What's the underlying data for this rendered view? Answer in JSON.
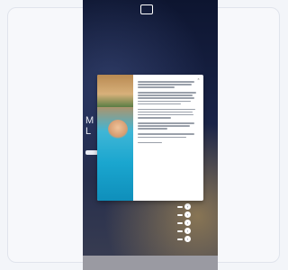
{
  "topbar": {
    "back_label": "",
    "logo_text": "",
    "nav": [
      "",
      "",
      "",
      ""
    ]
  },
  "hero": {
    "letters": [
      "M",
      "L"
    ],
    "button_label": ""
  },
  "modal": {
    "title": "",
    "salutation": "",
    "close_label": "×"
  },
  "quick_actions": [
    {
      "label": "",
      "icon": "chevron-icon"
    },
    {
      "label": "",
      "icon": "chevron-icon"
    },
    {
      "label": "",
      "icon": "chevron-icon"
    },
    {
      "label": "",
      "icon": "chevron-icon"
    },
    {
      "label": "",
      "icon": "chevron-icon"
    }
  ],
  "colors": {
    "phone_bg": "#1a2448",
    "accent_gold": "#d2aa5a",
    "modal_bg": "#ffffff"
  }
}
